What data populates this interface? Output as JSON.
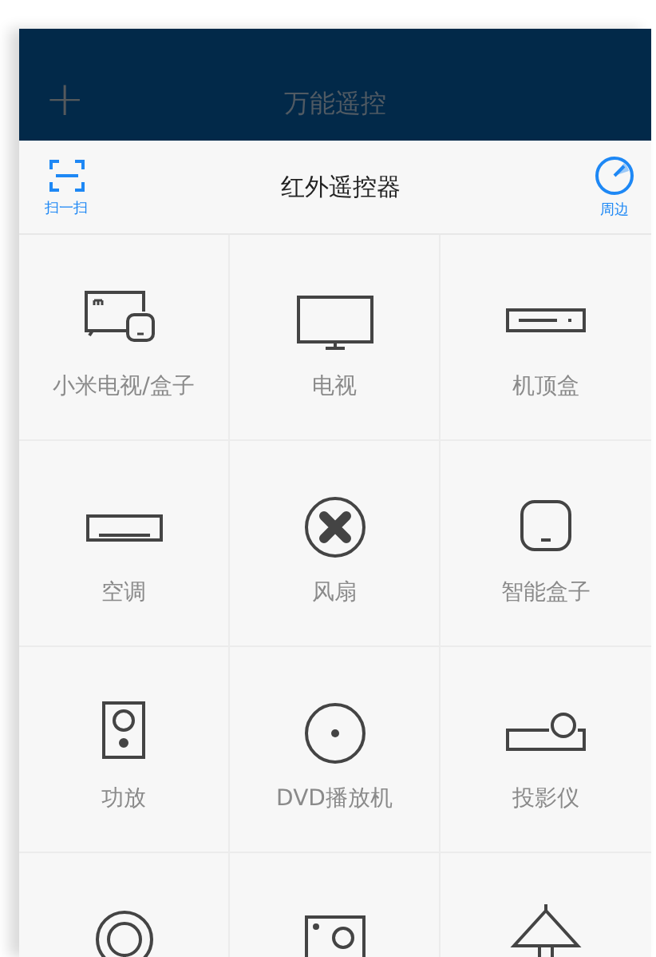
{
  "header": {
    "add_symbol": "+",
    "title": "万能遥控"
  },
  "toolbar": {
    "scan_label": "扫一扫",
    "title": "红外遥控器",
    "nearby_label": "周边"
  },
  "devices": [
    {
      "kind": "mi_tv_box",
      "label": "小米电视/盒子"
    },
    {
      "kind": "tv",
      "label": "电视"
    },
    {
      "kind": "set_top_box",
      "label": "机顶盒"
    },
    {
      "kind": "air_conditioner",
      "label": "空调"
    },
    {
      "kind": "fan",
      "label": "风扇"
    },
    {
      "kind": "smart_box",
      "label": "智能盒子"
    },
    {
      "kind": "amplifier",
      "label": "功放"
    },
    {
      "kind": "dvd",
      "label": "DVD播放机"
    },
    {
      "kind": "projector",
      "label": "投影仪"
    },
    {
      "kind": "ring"
    },
    {
      "kind": "camera"
    },
    {
      "kind": "lamp"
    }
  ]
}
